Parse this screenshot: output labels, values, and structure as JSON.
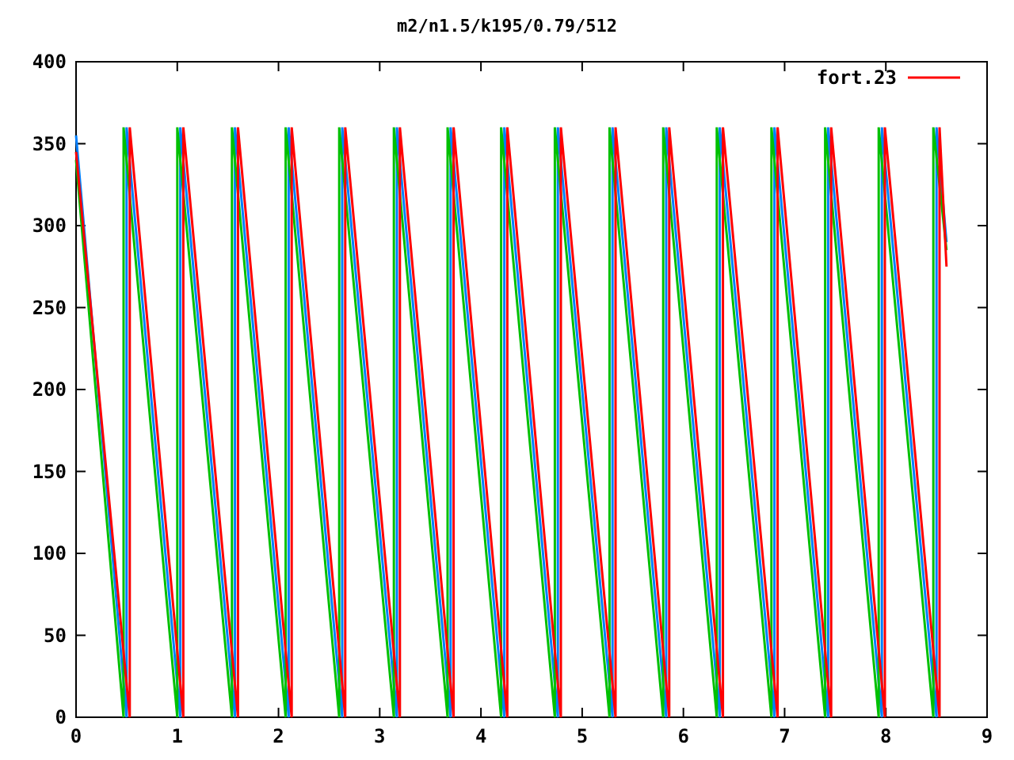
{
  "chart_data": {
    "type": "line",
    "title": "m2/n1.5/k195/0.79/512",
    "xlim": [
      0,
      9
    ],
    "ylim": [
      0,
      400
    ],
    "xticks": [
      0,
      1,
      2,
      3,
      4,
      5,
      6,
      7,
      8,
      9
    ],
    "yticks": [
      0,
      50,
      100,
      150,
      200,
      250,
      300,
      350,
      400
    ],
    "series": [
      {
        "color": "#0080ff",
        "x": [
          0,
          0.5,
          0.5,
          1.03,
          1.03,
          1.57,
          1.57,
          2.1,
          2.1,
          2.63,
          2.63,
          3.17,
          3.17,
          3.7,
          3.7,
          4.23,
          4.23,
          4.76,
          4.76,
          5.3,
          5.3,
          5.83,
          5.83,
          6.36,
          6.36,
          6.9,
          6.9,
          7.43,
          7.43,
          7.96,
          7.96,
          8.5,
          8.5,
          8.6
        ],
        "values": [
          355,
          0,
          360,
          0,
          360,
          0,
          360,
          0,
          360,
          0,
          360,
          0,
          360,
          0,
          360,
          0,
          360,
          0,
          360,
          0,
          360,
          0,
          360,
          0,
          360,
          0,
          360,
          0,
          360,
          0,
          360,
          0,
          360,
          290
        ]
      },
      {
        "color": "#00c000",
        "x": [
          0,
          0.47,
          0.47,
          1.0,
          1.0,
          1.54,
          1.54,
          2.07,
          2.07,
          2.6,
          2.6,
          3.14,
          3.14,
          3.67,
          3.67,
          4.2,
          4.2,
          4.73,
          4.73,
          5.27,
          5.27,
          5.8,
          5.8,
          6.33,
          6.33,
          6.87,
          6.87,
          7.4,
          7.4,
          7.93,
          7.93,
          8.47,
          8.47,
          8.6
        ],
        "values": [
          340,
          0,
          360,
          0,
          360,
          0,
          360,
          0,
          360,
          0,
          360,
          0,
          360,
          0,
          360,
          0,
          360,
          0,
          360,
          0,
          360,
          0,
          360,
          0,
          360,
          0,
          360,
          0,
          360,
          0,
          360,
          0,
          360,
          285
        ]
      },
      {
        "name": "fort.23",
        "color": "#ff0000",
        "x": [
          0,
          0.53,
          0.53,
          1.06,
          1.06,
          1.6,
          1.6,
          2.13,
          2.13,
          2.66,
          2.66,
          3.2,
          3.2,
          3.73,
          3.73,
          4.26,
          4.26,
          4.79,
          4.79,
          5.33,
          5.33,
          5.86,
          5.86,
          6.39,
          6.39,
          6.93,
          6.93,
          7.46,
          7.46,
          7.99,
          7.99,
          8.53,
          8.53,
          8.6
        ],
        "values": [
          345,
          0,
          360,
          0,
          360,
          0,
          360,
          0,
          360,
          0,
          360,
          0,
          360,
          0,
          360,
          0,
          360,
          0,
          360,
          0,
          360,
          0,
          360,
          0,
          360,
          0,
          360,
          0,
          360,
          0,
          360,
          0,
          360,
          275
        ]
      }
    ]
  }
}
